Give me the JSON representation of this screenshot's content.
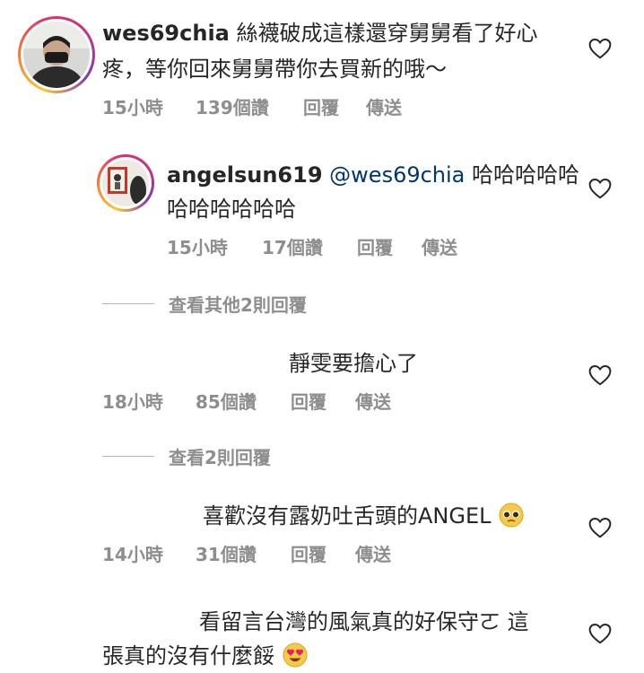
{
  "comments": [
    {
      "username": "wes69chia",
      "text_line1": "絲襪破成這樣還穿舅舅看了好心",
      "text_line2": "疼，等你回來舅舅帶你去買新的哦～",
      "time": "15小時",
      "likes": "139個讚",
      "reply": "回覆",
      "send": "傳送",
      "reply_comment": {
        "username": "angelsun619",
        "mention": "@wes69chia",
        "text_line1": "哈哈哈哈哈",
        "text_line2": "哈哈哈哈哈哈",
        "time": "15小時",
        "likes": "17個讚",
        "reply": "回覆",
        "send": "傳送"
      },
      "view_more": "查看其他2則回覆"
    },
    {
      "text_line1": "靜雯要擔心了",
      "time": "18小時",
      "likes": "85個讚",
      "reply": "回覆",
      "send": "傳送",
      "view_more": "查看2則回覆"
    },
    {
      "text_line1": "喜歡沒有露奶吐舌頭的ANGEL",
      "emoji": "pleading-face-emoji",
      "time": "14小時",
      "likes": "31個讚",
      "reply": "回覆",
      "send": "傳送"
    },
    {
      "text_line1": "看留言台灣的風氣真的好保守ㄛ 這",
      "text_line2": "張真的沒有什麼餒",
      "emoji": "heart-eyes-emoji"
    }
  ],
  "icons": {
    "like": "heart-outline-icon"
  },
  "colors": {
    "text": "#262626",
    "meta": "#8e8e8e",
    "mention": "#00376b"
  }
}
